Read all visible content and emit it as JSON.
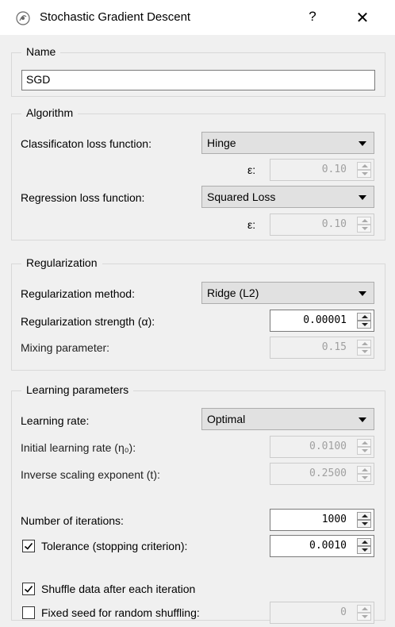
{
  "window": {
    "title": "Stochastic Gradient Descent",
    "help": "?",
    "close": "✕",
    "icon": "orange-widget-icon"
  },
  "name_group": {
    "title": "Name",
    "value": "SGD"
  },
  "algorithm": {
    "title": "Algorithm",
    "classification_label": "Classificaton loss function:",
    "classification_value": "Hinge",
    "epsilon1_label": "ε:",
    "epsilon1_value": "0.10",
    "regression_label": "Regression loss function:",
    "regression_value": "Squared Loss",
    "epsilon2_label": "ε:",
    "epsilon2_value": "0.10"
  },
  "regularization": {
    "title": "Regularization",
    "method_label": "Regularization method:",
    "method_value": "Ridge (L2)",
    "strength_label": "Regularization strength (α):",
    "strength_value": "0.00001",
    "mixing_label": "Mixing parameter:",
    "mixing_value": "0.15"
  },
  "learning": {
    "title": "Learning parameters",
    "rate_label": "Learning rate:",
    "rate_value": "Optimal",
    "initial_label": "Initial learning rate (η₀):",
    "initial_value": "0.0100",
    "inverse_label": "Inverse scaling exponent (t):",
    "inverse_value": "0.2500",
    "iterations_label": "Number of iterations:",
    "iterations_value": "1000",
    "tolerance_label": "Tolerance (stopping criterion):",
    "tolerance_checked": true,
    "tolerance_value": "0.0010",
    "shuffle_label": "Shuffle data after each iteration",
    "shuffle_checked": true,
    "seed_label": "Fixed seed for random shuffling:",
    "seed_checked": false,
    "seed_value": "0"
  }
}
